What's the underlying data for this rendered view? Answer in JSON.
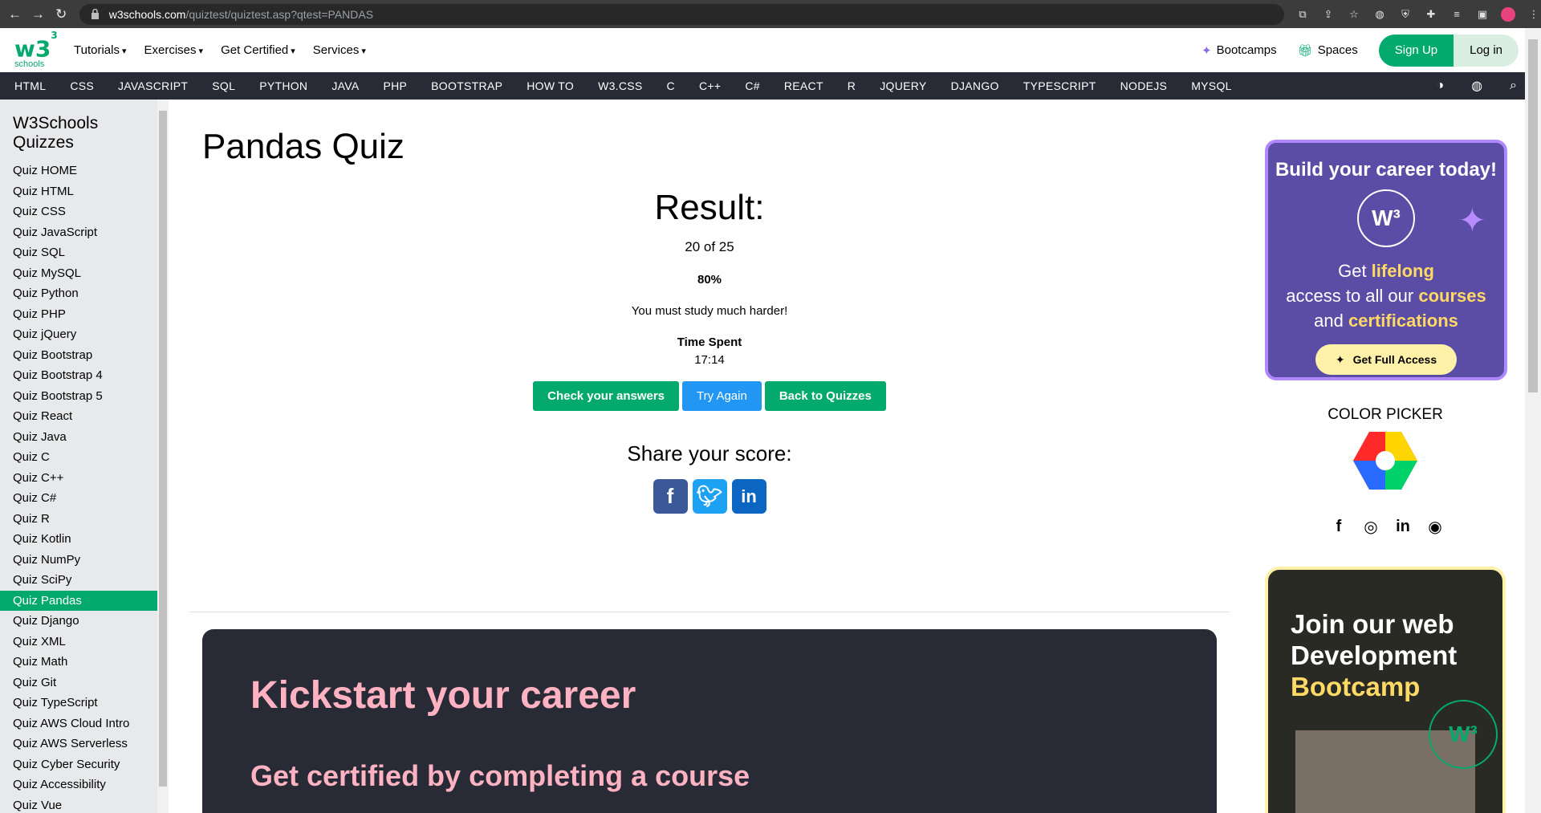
{
  "browser": {
    "url_host": "w3schools.com",
    "url_path": "/quiztest/quiztest.asp?qtest=PANDAS"
  },
  "topnav": {
    "logo_text": "w3",
    "logo_sup": "3",
    "logo_sub": "schools",
    "menu": [
      "Tutorials",
      "Exercises",
      "Get Certified",
      "Services"
    ],
    "bootcamps": "Bootcamps",
    "spaces": "Spaces",
    "signup": "Sign Up",
    "login": "Log in"
  },
  "subnav": {
    "items": [
      "HTML",
      "CSS",
      "JAVASCRIPT",
      "SQL",
      "PYTHON",
      "JAVA",
      "PHP",
      "BOOTSTRAP",
      "HOW TO",
      "W3.CSS",
      "C",
      "C++",
      "C#",
      "REACT",
      "R",
      "JQUERY",
      "DJANGO",
      "TYPESCRIPT",
      "NODEJS",
      "MYSQL"
    ]
  },
  "sidebar": {
    "title": "W3Schools Quizzes",
    "items": [
      "Quiz HOME",
      "Quiz HTML",
      "Quiz CSS",
      "Quiz JavaScript",
      "Quiz SQL",
      "Quiz MySQL",
      "Quiz Python",
      "Quiz PHP",
      "Quiz jQuery",
      "Quiz Bootstrap",
      "Quiz Bootstrap 4",
      "Quiz Bootstrap 5",
      "Quiz React",
      "Quiz Java",
      "Quiz C",
      "Quiz C++",
      "Quiz C#",
      "Quiz R",
      "Quiz Kotlin",
      "Quiz NumPy",
      "Quiz SciPy",
      "Quiz Pandas",
      "Quiz Django",
      "Quiz XML",
      "Quiz Math",
      "Quiz Git",
      "Quiz TypeScript",
      "Quiz AWS Cloud Intro",
      "Quiz AWS Serverless",
      "Quiz Cyber Security",
      "Quiz Accessibility",
      "Quiz Vue"
    ],
    "active_index": 21
  },
  "main": {
    "title": "Pandas Quiz",
    "result_title": "Result:",
    "score": "20 of 25",
    "percent": "80%",
    "message": "You must study much harder!",
    "time_label": "Time Spent",
    "time_value": "17:14",
    "buttons": {
      "check": "Check your answers",
      "try": "Try Again",
      "back": "Back to Quizzes"
    },
    "share_title": "Share your score:",
    "kickstart": "Kickstart your career",
    "certified": "Get certified by completing a course"
  },
  "right": {
    "career_title": "Build your career today!",
    "career_line1_pre": "Get ",
    "career_line1_hl": "lifelong",
    "career_line2_pre": "access to all our ",
    "career_line2_hl": "courses",
    "career_line3_pre": "and ",
    "career_line3_hl": "certifications",
    "get_access": "Get Full Access",
    "color_picker": "COLOR PICKER",
    "bootcamp_line1": "Join our web",
    "bootcamp_line2": "Development",
    "bootcamp_line3": "Bootcamp"
  },
  "colors": {
    "brand_green": "#04aa6d",
    "dark_nav": "#282a35",
    "try_blue": "#2196f3",
    "pink": "#ffb3c2"
  }
}
